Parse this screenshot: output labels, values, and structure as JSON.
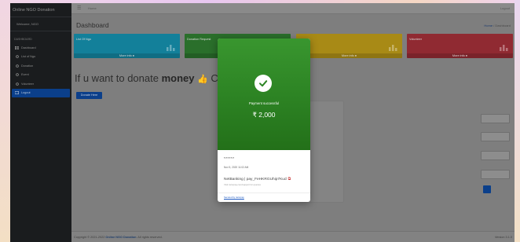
{
  "app": {
    "brand": "Online NGO Donation",
    "user": "Welcome, NGO"
  },
  "sidebar": {
    "header": "DASHBOARD",
    "items": [
      {
        "label": "Dashboard",
        "icon": "dashboard-icon",
        "active": false
      },
      {
        "label": "List of Ngo",
        "icon": "circle-icon",
        "active": false
      },
      {
        "label": "Donation",
        "icon": "circle-icon",
        "active": false
      },
      {
        "label": "Event",
        "icon": "circle-icon",
        "active": false
      },
      {
        "label": "Volunteer",
        "icon": "circle-icon",
        "active": false
      },
      {
        "label": "Logout",
        "icon": "logout-icon",
        "active": true
      }
    ]
  },
  "topbar": {
    "menu_icon": "hamburger-icon",
    "home": "Home",
    "logout": "Logout"
  },
  "page": {
    "title": "Dashboard",
    "breadcrumb_home": "Home",
    "breadcrumb_sep": "/",
    "breadcrumb_current": "Dashboard"
  },
  "boxes": [
    {
      "label": "List Of Ngo",
      "more": "More info",
      "color": "#13809a"
    },
    {
      "label": "Donation Request",
      "more": "More info",
      "color": "#2a6f2b"
    },
    {
      "label": "",
      "more": "More info",
      "color": "#a88a16"
    },
    {
      "label": "Volunteer",
      "more": "More info",
      "color": "#902a32"
    }
  ],
  "donate": {
    "prefix": "If u want to donate ",
    "bold": "money",
    "suffix": " Cli",
    "button": "Donate Here"
  },
  "modal": {
    "status": "Payment successful",
    "amount": "₹ 2,000",
    "masked": "******",
    "date": "Nov 5, 2020 11:02 AM",
    "ref": "NetBanking | pay_FeHKRGUhip7Kud",
    "note": "Visit razorpay.com/support for queries",
    "secured": "Secured by razorpay"
  },
  "footer": {
    "copyright": "Copyright © 2021-2022 ",
    "brand": "Online NGO Donation",
    "rights": ". All rights reserved.",
    "version": "Version 3.1.0"
  },
  "colors": {
    "sidebar_bg": "#1a1c1e",
    "active": "#0b3f8a",
    "success": "#2d8424"
  }
}
